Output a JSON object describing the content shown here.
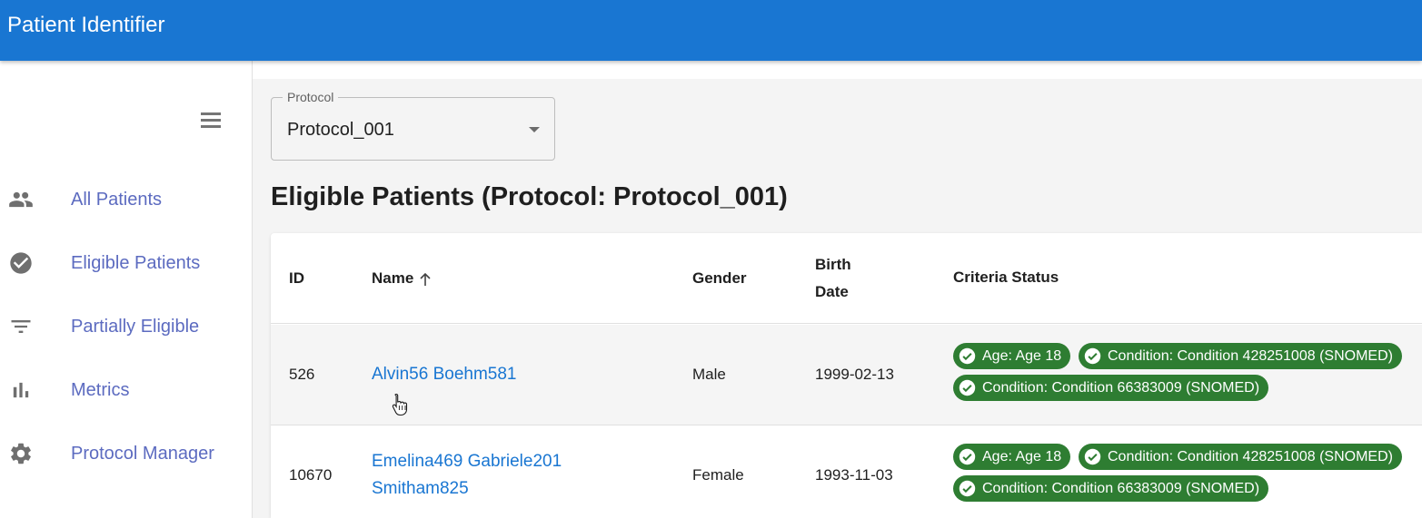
{
  "app": {
    "title": "Patient Identifier"
  },
  "sidebar": {
    "items": [
      {
        "label": "All Patients",
        "icon": "people-icon"
      },
      {
        "label": "Eligible Patients",
        "icon": "check-circle-icon"
      },
      {
        "label": "Partially Eligible",
        "icon": "filter-list-icon"
      },
      {
        "label": "Metrics",
        "icon": "bar-chart-icon"
      },
      {
        "label": "Protocol Manager",
        "icon": "gear-icon"
      }
    ]
  },
  "protocol_select": {
    "label": "Protocol",
    "value": "Protocol_001"
  },
  "page": {
    "title": "Eligible Patients (Protocol: Protocol_001)"
  },
  "table": {
    "headers": {
      "id": "ID",
      "name": "Name",
      "gender": "Gender",
      "birth_date_line1": "Birth",
      "birth_date_line2": "Date",
      "criteria": "Criteria Status"
    },
    "rows": [
      {
        "id": "526",
        "name_line1": "Alvin56 Boehm581",
        "name_line2": "",
        "gender": "Male",
        "birth_date": "1999-02-13",
        "criteria": [
          "Age: Age 18",
          "Condition: Condition 428251008 (SNOMED)",
          "Condition: Condition 66383009 (SNOMED)"
        ]
      },
      {
        "id": "10670",
        "name_line1": "Emelina469 Gabriele201",
        "name_line2": "Smitham825",
        "gender": "Female",
        "birth_date": "1993-11-03",
        "criteria": [
          "Age: Age 18",
          "Condition: Condition 428251008 (SNOMED)",
          "Condition: Condition 66383009 (SNOMED)"
        ]
      }
    ]
  },
  "colors": {
    "appbar": "#1976d2",
    "nav_label": "#5c6bc0",
    "chip": "#2e7d32",
    "link": "#1976d2"
  }
}
